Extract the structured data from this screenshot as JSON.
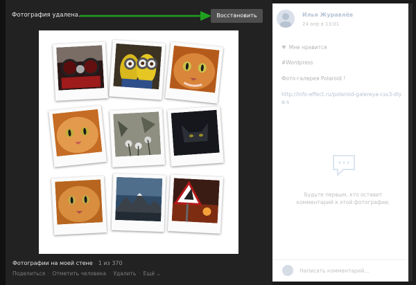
{
  "viewer": {
    "status_text": "Фотография удалена.",
    "restore_button": "Восстановить",
    "caption_title": "Фотографии на моей стене",
    "counter": "1 из 370",
    "actions": [
      "Поделиться",
      "Отметить человека",
      "Удалить",
      "Ещё ⌄"
    ]
  },
  "sidebar": {
    "author": "Илья Журавлёв",
    "date": "24 апр в 13:01",
    "like_label": "Мне нравится",
    "hashtag": "#Wordpress",
    "gallery_title": "Фото-галерея Polaroid !",
    "link": "http://info-effect.ru/polaroid-galereya-css3-dlya-s",
    "no_comments": "Будьте первым, кто оставит комментарий к этой фотографии.",
    "comment_placeholder": "Написать комментарий..."
  },
  "colors": {
    "viewer_bg": "#222222",
    "restore_button_bg": "#4e4e4e",
    "arrow": "#1fa01f"
  },
  "icons": [
    "heart-icon",
    "speech-bubble-icon",
    "green-arrow-icon"
  ]
}
